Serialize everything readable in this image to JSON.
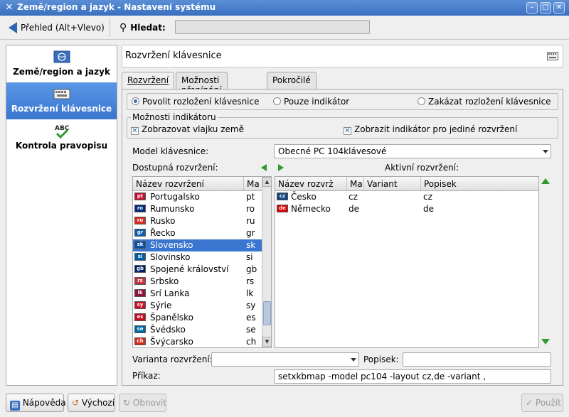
{
  "window": {
    "title": "Země/region a jazyk - Nastavení systému"
  },
  "toolbar": {
    "overview_label": "Přehled (Alt+Vlevo)",
    "search_label": "Hledat:",
    "search_value": ""
  },
  "sidebar": {
    "items": [
      {
        "label": "Země/region a jazyk",
        "icon": "globe-flag-icon",
        "active": false
      },
      {
        "label": "Rozvržení klávesnice",
        "icon": "keyboard-icon",
        "active": true
      },
      {
        "label": "Kontrola pravopisu",
        "icon": "spellcheck-icon",
        "active": false
      }
    ]
  },
  "page": {
    "title": "Rozvržení klávesnice"
  },
  "tabs": [
    {
      "label": "Rozvržení",
      "active": true
    },
    {
      "label": "Možnosti přepínání",
      "active": false
    },
    {
      "label": "Pokročilé",
      "active": false
    }
  ],
  "layout_mode": {
    "options": [
      {
        "label": "Povolit rozložení klávesnice",
        "selected": true
      },
      {
        "label": "Pouze indikátor",
        "selected": false
      },
      {
        "label": "Zakázat rozložení klávesnice",
        "selected": false
      }
    ]
  },
  "indicator": {
    "group_label": "Možnosti indikátoru",
    "show_flag_label": "Zobrazovat vlajku země",
    "show_flag_checked": true,
    "single_layout_label": "Zobrazit indikátor pro jediné rozvržení",
    "single_layout_checked": true
  },
  "keyboard_model": {
    "label": "Model klávesnice:",
    "value": "Obecné PC 104klávesové"
  },
  "available": {
    "label": "Dostupná rozvržení:",
    "columns": [
      "Název rozvržení",
      "Ma"
    ],
    "rows": [
      {
        "name": "Portugalsko",
        "code": "pt",
        "flag": "pt",
        "flag_color": "#c8102e",
        "selected": false
      },
      {
        "name": "Rumunsko",
        "code": "ro",
        "flag": "ro",
        "flag_color": "#002b7f",
        "selected": false
      },
      {
        "name": "Rusko",
        "code": "ru",
        "flag": "ru",
        "flag_color": "#d52b1e",
        "selected": false
      },
      {
        "name": "Řecko",
        "code": "gr",
        "flag": "gr",
        "flag_color": "#0d5eaf",
        "selected": false
      },
      {
        "name": "Slovensko",
        "code": "sk",
        "flag": "sk",
        "flag_color": "#0b4ea2",
        "selected": true
      },
      {
        "name": "Slovinsko",
        "code": "si",
        "flag": "si",
        "flag_color": "#005da4",
        "selected": false
      },
      {
        "name": "Spojené království",
        "code": "gb",
        "flag": "gb",
        "flag_color": "#012169",
        "selected": false
      },
      {
        "name": "Srbsko",
        "code": "rs",
        "flag": "rs",
        "flag_color": "#c6363c",
        "selected": false
      },
      {
        "name": "Srí Lanka",
        "code": "lk",
        "flag": "lk",
        "flag_color": "#8d153a",
        "selected": false
      },
      {
        "name": "Sýrie",
        "code": "sy",
        "flag": "sy",
        "flag_color": "#ce1126",
        "selected": false
      },
      {
        "name": "Španělsko",
        "code": "es",
        "flag": "es",
        "flag_color": "#c60b1e",
        "selected": false
      },
      {
        "name": "Švédsko",
        "code": "se",
        "flag": "se",
        "flag_color": "#006aa7",
        "selected": false
      },
      {
        "name": "Švýcarsko",
        "code": "ch",
        "flag": "ch",
        "flag_color": "#d52b1e",
        "selected": false
      }
    ]
  },
  "active": {
    "label": "Aktivní rozvržení:",
    "columns": [
      "Název rozvrž",
      "Ma",
      "Variant",
      "Popisek"
    ],
    "rows": [
      {
        "name": "Česko",
        "code": "cz",
        "variant": "",
        "label": "cz",
        "flag": "cz",
        "flag_color": "#11457e"
      },
      {
        "name": "Německo",
        "code": "de",
        "variant": "",
        "label": "de",
        "flag": "de",
        "flag_color": "#dd0000"
      }
    ]
  },
  "variant": {
    "label": "Varianta rozvržení:",
    "value": ""
  },
  "popisek": {
    "label": "Popisek:",
    "value": ""
  },
  "command": {
    "label": "Příkaz:",
    "value": "setxkbmap -model pc104 -layout cz,de -variant ,"
  },
  "buttons": {
    "help": "Nápověda",
    "defaults": "Výchozí",
    "reset": "Obnovit",
    "apply": "Použít"
  }
}
